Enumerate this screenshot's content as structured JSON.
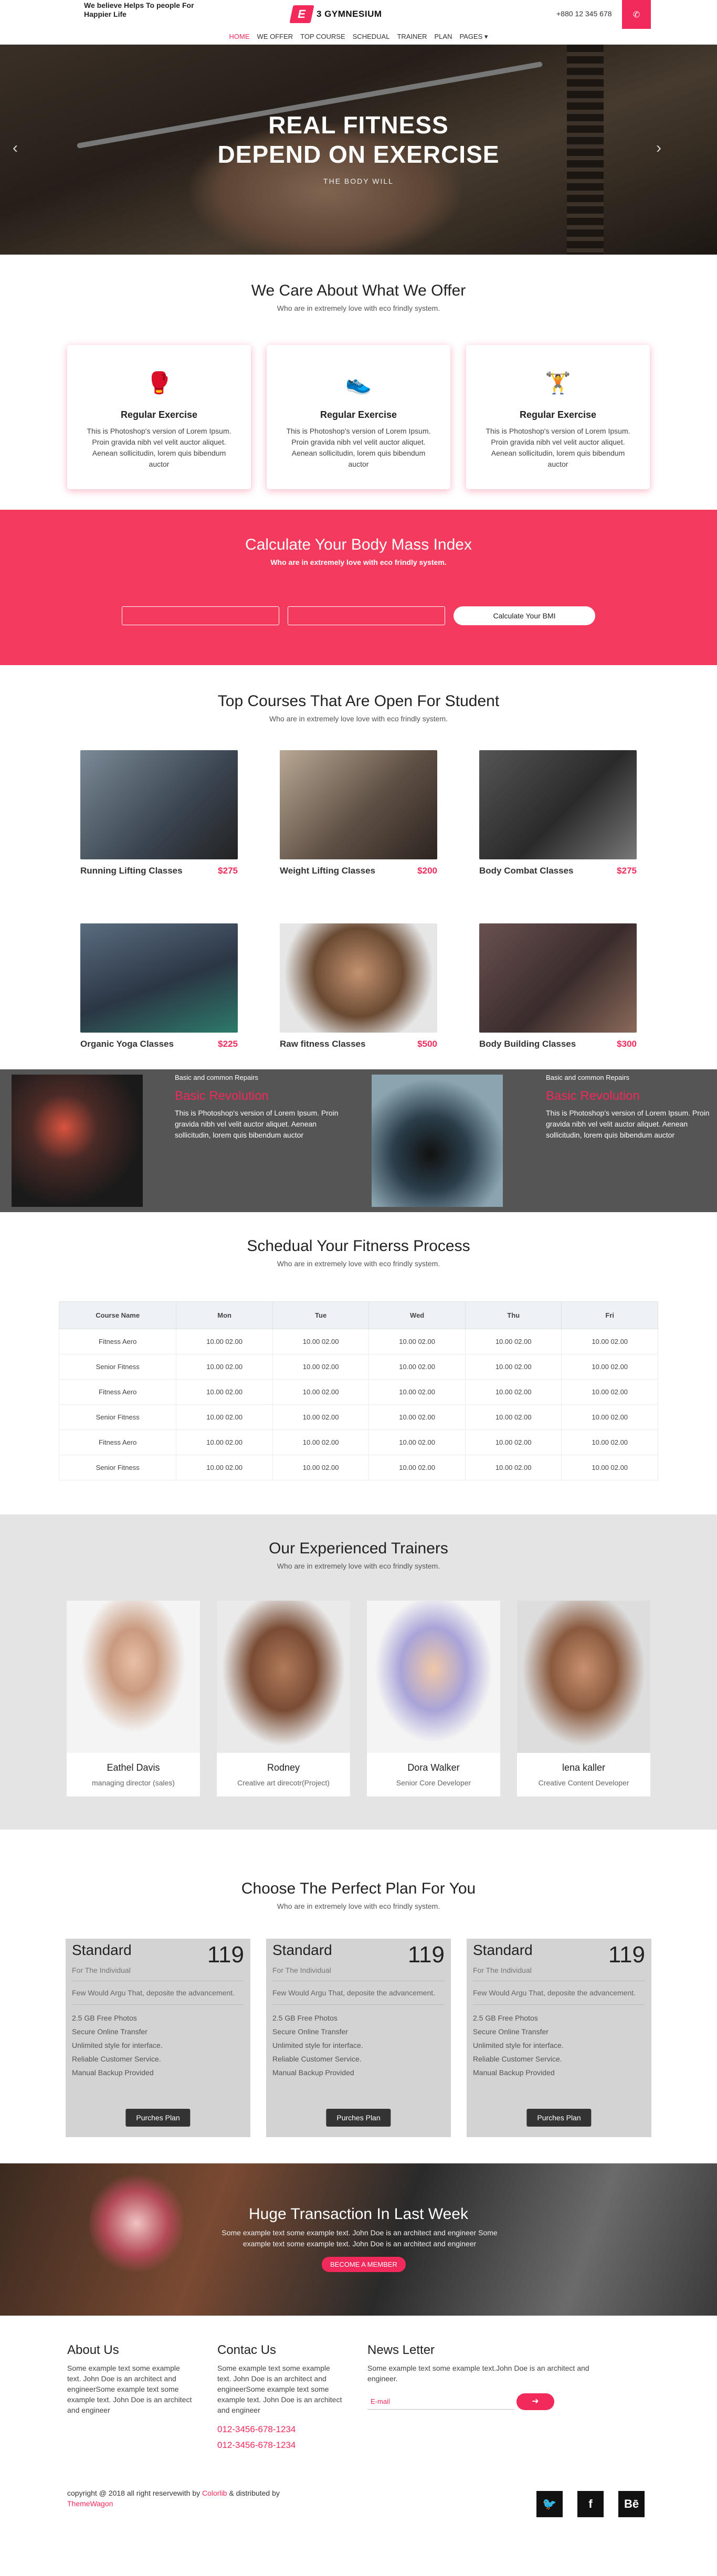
{
  "topbar": {
    "tagline": "We believe Helps To people For Happier Life",
    "logo_mark": "E",
    "logo_text": "3 GYMNESIUM",
    "phone": "+880 12 345 678",
    "call_icon": "phone-icon"
  },
  "nav": {
    "items": [
      "HOME",
      "WE OFFER",
      "TOP COURSE",
      "SCHEDUAL",
      "TRAINER",
      "PLAN",
      "PAGES ▾"
    ]
  },
  "hero": {
    "title_line1": "REAL FITNESS",
    "title_line2": "DEPEND ON EXERCISE",
    "subtitle": "THE BODY WILL",
    "prev": "‹",
    "next": "›"
  },
  "offer": {
    "title": "We Care About What We Offer",
    "subtitle": "Who are in extremely love with eco frindly system.",
    "cards": [
      {
        "icon": "🥊",
        "title": "Regular Exercise",
        "text": "This is Photoshop's version of Lorem Ipsum. Proin gravida nibh vel velit auctor aliquet. Aenean sollicitudin, lorem quis bibendum auctor"
      },
      {
        "icon": "👟",
        "title": "Regular Exercise",
        "text": "This is Photoshop's version of Lorem Ipsum. Proin gravida nibh vel velit auctor aliquet. Aenean sollicitudin, lorem quis bibendum auctor"
      },
      {
        "icon": "🏋",
        "title": "Regular Exercise",
        "text": "This is Photoshop's version of Lorem Ipsum. Proin gravida nibh vel velit auctor aliquet. Aenean sollicitudin, lorem quis bibendum auctor"
      }
    ]
  },
  "bmi": {
    "title": "Calculate Your Body Mass Index",
    "subtitle": "Who are in extremely love with eco frindly system.",
    "button": "Calculate Your BMI"
  },
  "courses": {
    "title": "Top Courses That Are Open For Student",
    "subtitle": "Who are in extremely love love with eco frindly system.",
    "items": [
      {
        "name": "Running Lifting Classes",
        "price": "$275",
        "color": "#4e5a66"
      },
      {
        "name": "Weight Lifting Classes",
        "price": "$200",
        "color": "#6f6258"
      },
      {
        "name": "Body Combat Classes",
        "price": "$275",
        "color": "#3b3b3b"
      },
      {
        "name": "Organic Yoga Classes",
        "price": "$225",
        "color": "#3d4a58"
      },
      {
        "name": "Raw fitness Classes",
        "price": "$500",
        "color": "#7a5a40"
      },
      {
        "name": "Body Building Classes",
        "price": "$300",
        "color": "#4a3c3c"
      }
    ]
  },
  "revolution": [
    {
      "small": "Basic and common Repairs",
      "title": "Basic Revolution",
      "text": "This is Photoshop's version of Lorem Ipsum. Proin gravida nibh vel velit auctor aliquet. Aenean sollicitudin, lorem quis bibendum auctor"
    },
    {
      "small": "Basic and common Repairs",
      "title": "Basic Revolution",
      "text": "This is Photoshop's version of Lorem Ipsum. Proin gravida nibh vel velit auctor aliquet. Aenean sollicitudin, lorem quis bibendum auctor"
    }
  ],
  "schedule": {
    "title": "Schedual Your Fitnerss Process",
    "subtitle": "Who are in extremely love with eco frindly system.",
    "headers": [
      "Course Name",
      "Mon",
      "Tue",
      "Wed",
      "Thu",
      "Fri"
    ],
    "rows": [
      [
        "Fitness Aero",
        "10.00 02.00",
        "10.00 02.00",
        "10.00 02.00",
        "10.00 02.00",
        "10.00 02.00"
      ],
      [
        "Senior Fitness",
        "10.00 02.00",
        "10.00 02.00",
        "10.00 02.00",
        "10.00 02.00",
        "10.00 02.00"
      ],
      [
        "Fitness Aero",
        "10.00 02.00",
        "10.00 02.00",
        "10.00 02.00",
        "10.00 02.00",
        "10.00 02.00"
      ],
      [
        "Senior Fitness",
        "10.00 02.00",
        "10.00 02.00",
        "10.00 02.00",
        "10.00 02.00",
        "10.00 02.00"
      ],
      [
        "Fitness Aero",
        "10.00 02.00",
        "10.00 02.00",
        "10.00 02.00",
        "10.00 02.00",
        "10.00 02.00"
      ],
      [
        "Senior Fitness",
        "10.00 02.00",
        "10.00 02.00",
        "10.00 02.00",
        "10.00 02.00",
        "10.00 02.00"
      ]
    ]
  },
  "trainers": {
    "title": "Our Experienced Trainers",
    "subtitle": "Who are in extremely love with eco frindly system.",
    "items": [
      {
        "name": "Eathel Davis",
        "role": "managing director (sales)"
      },
      {
        "name": "Rodney",
        "role": "Creative art direcotr(Project)"
      },
      {
        "name": "Dora Walker",
        "role": "Senior Core Developer"
      },
      {
        "name": "lena kaller",
        "role": "Creative Content Developer"
      }
    ]
  },
  "plans": {
    "title": "Choose The Perfect Plan For You",
    "subtitle": "Who are in extremely love with eco frindly system.",
    "items": [
      {
        "name": "Standard",
        "price": "119",
        "for": "For The Individual",
        "desc": "Few Would Argu That, deposite the advancement.",
        "features": [
          "2.5 GB Free Photos",
          "Secure Online Transfer",
          "Unlimited style for interface.",
          "Reliable Customer Service.",
          "Manual Backup Provided"
        ],
        "button": "Purches Plan"
      },
      {
        "name": "Standard",
        "price": "119",
        "for": "For The Individual",
        "desc": "Few Would Argu That, deposite the advancement.",
        "features": [
          "2.5 GB Free Photos",
          "Secure Online Transfer",
          "Unlimited style for interface.",
          "Reliable Customer Service.",
          "Manual Backup Provided"
        ],
        "button": "Purches Plan"
      },
      {
        "name": "Standard",
        "price": "119",
        "for": "For The Individual",
        "desc": "Few Would Argu That, deposite the advancement.",
        "features": [
          "2.5 GB Free Photos",
          "Secure Online Transfer",
          "Unlimited style for interface.",
          "Reliable Customer Service.",
          "Manual Backup Provided"
        ],
        "button": "Purches Plan"
      }
    ]
  },
  "member": {
    "title": "Huge Transaction In Last Week",
    "text": "Some example text some example text. John Doe is an architect and engineer Some example text some example text. John Doe is an architect and engineer",
    "button": "BECOME A MEMBER"
  },
  "footer": {
    "about_title": "About Us",
    "about_text": "Some example text some example text. John Doe is an architect and engineerSome example text some example text. John Doe is an architect and engineer",
    "contact_title": "Contac Us",
    "contact_text": "Some example text some example text. John Doe is an architect and engineerSome example text some example text. John Doe is an architect and engineer",
    "tel1": "012-3456-678-1234",
    "tel2": "012-3456-678-1234",
    "news_title": "News Letter",
    "news_text": "Some example text some example text.John Doe is an architect and engineer.",
    "email_placeholder": "E-mail",
    "copy_prefix": "copyright @ 2018 all right reservewith by",
    "colorlib": "Colorlib",
    "copy_mid": "& distributed by",
    "themewagon": "ThemeWagon",
    "social": [
      "twitter-icon",
      "facebook-icon",
      "behance-icon"
    ]
  }
}
